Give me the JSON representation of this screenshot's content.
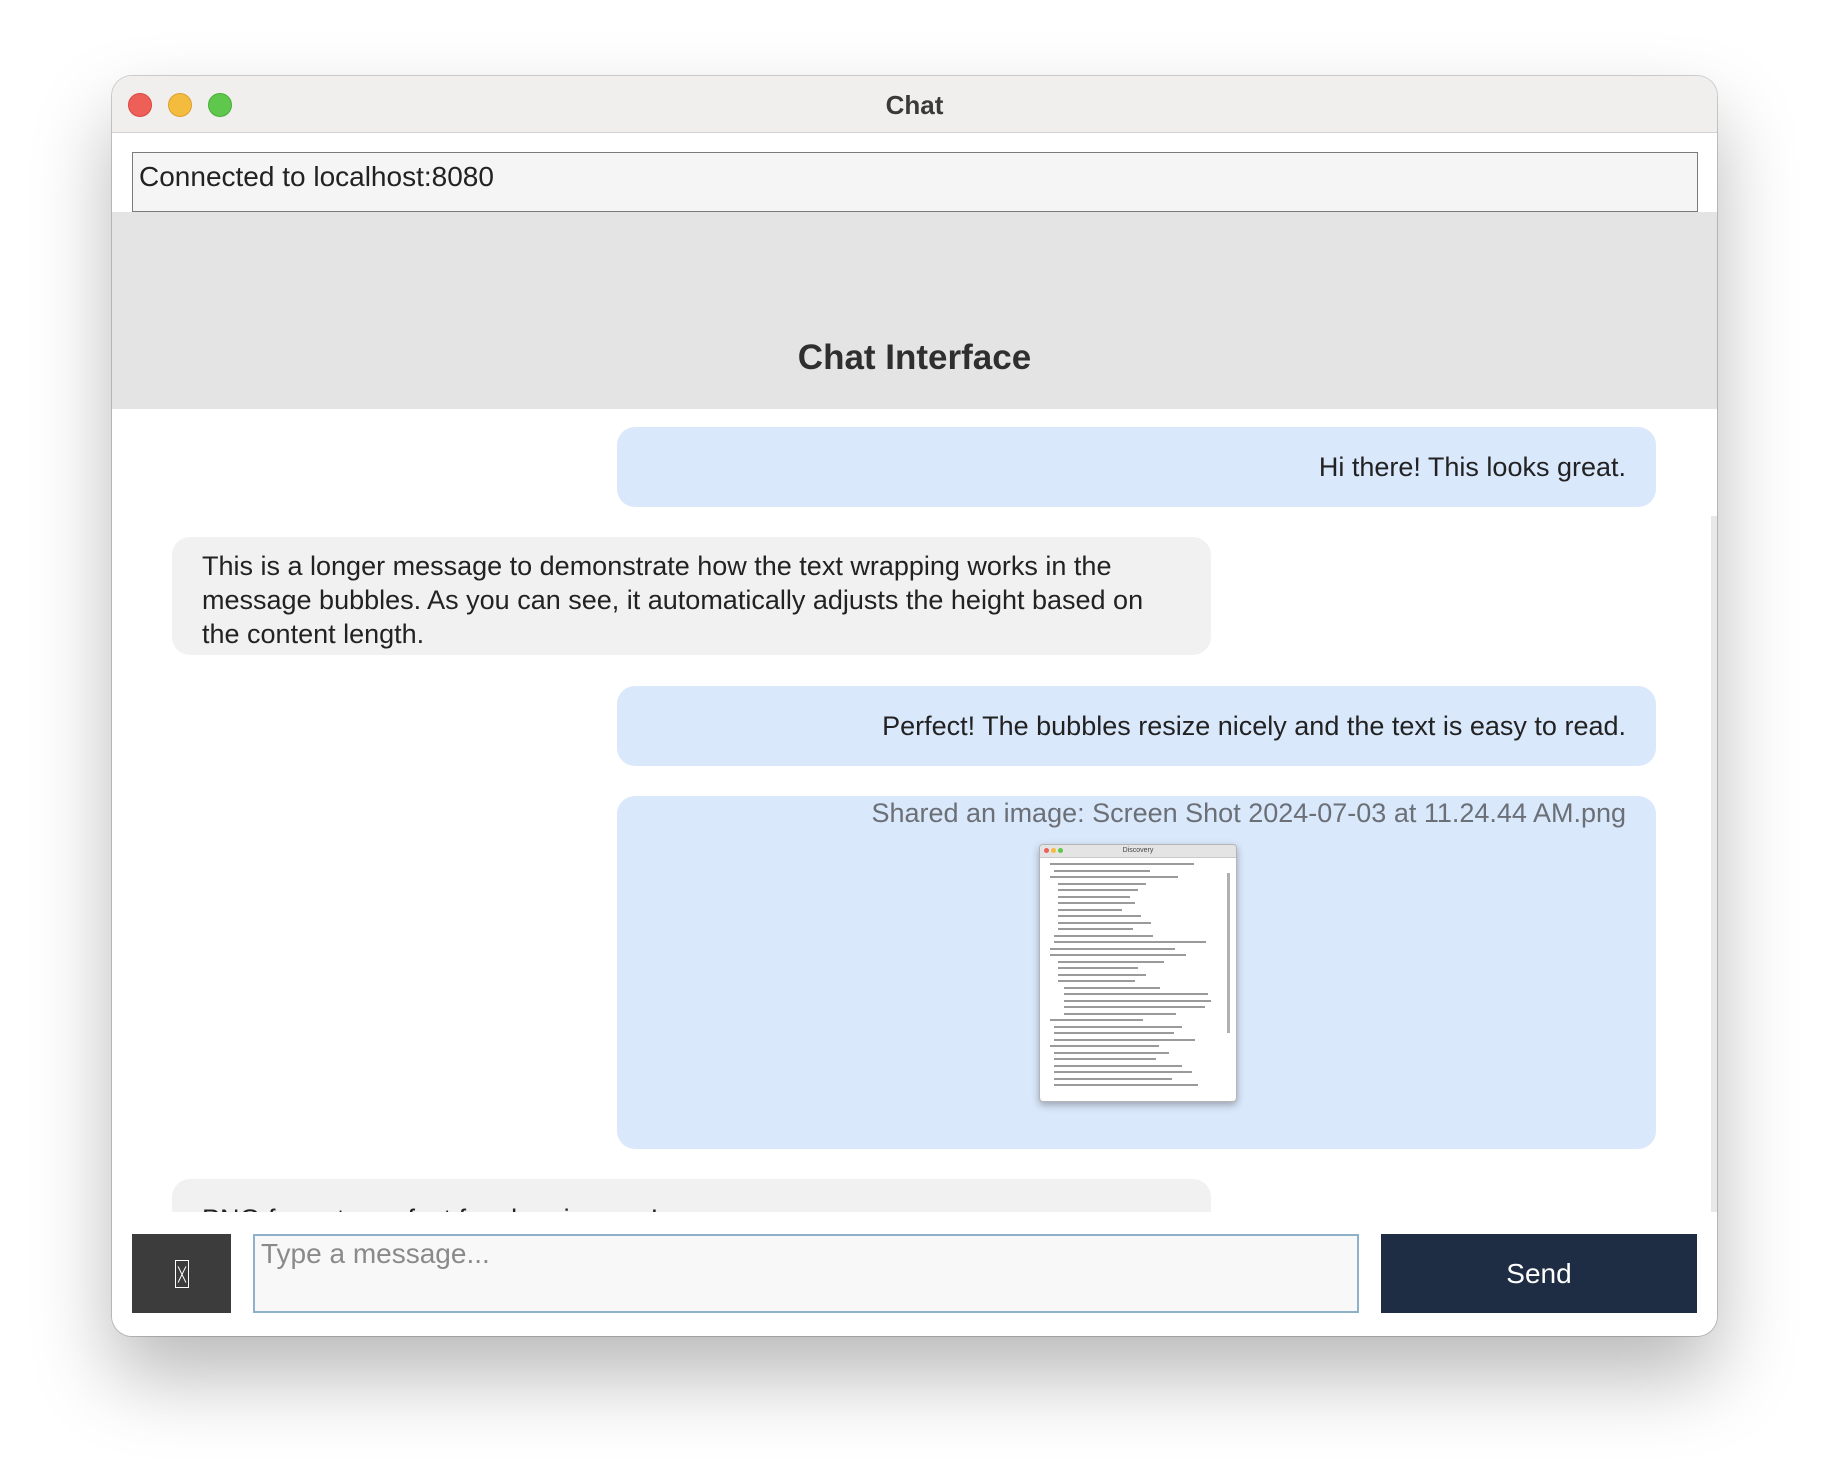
{
  "window": {
    "title": "Chat"
  },
  "status": {
    "text": "Connected to localhost:8080"
  },
  "header": {
    "title": "Chat Interface"
  },
  "messages": [
    {
      "type": "sent",
      "text": "Hi there! This looks great."
    },
    {
      "type": "received",
      "text": "This is a longer message to demonstrate how the text wrapping works in the message bubbles. As you can see, it automatically adjusts the height based on the content length."
    },
    {
      "type": "sent",
      "text": "Perfect! The bubbles resize nicely and the text is easy to read."
    },
    {
      "type": "sent",
      "text": "Shared an image: Screen Shot 2024-07-03 at 11.24.44 AM.png",
      "thumbnail_title": "Discovery"
    },
    {
      "type": "received",
      "text": "PNG format - perfect for clear images!"
    }
  ],
  "composer": {
    "attach_icon": "image-placeholder-icon",
    "placeholder": "Type a message...",
    "value": "",
    "send_label": "Send"
  },
  "colors": {
    "sent_bubble": "#dae8fc",
    "received_bubble": "#f1f1f1",
    "send_button": "#1f2d44",
    "attach_button": "#3c3c3c",
    "header_bg": "#e4e4e4"
  }
}
